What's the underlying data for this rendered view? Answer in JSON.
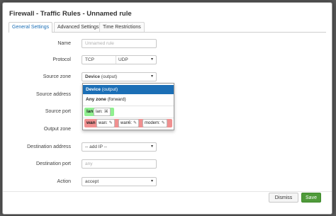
{
  "modal": {
    "title": "Firewall - Traffic Rules - Unnamed rule"
  },
  "tabs": [
    {
      "label": "General Settings"
    },
    {
      "label": "Advanced Settings"
    },
    {
      "label": "Time Restrictions"
    }
  ],
  "form": {
    "name_label": "Name",
    "name_placeholder": "Unnamed rule",
    "protocol_label": "Protocol",
    "protocol_tcp": "TCP",
    "protocol_udp": "UDP",
    "source_zone_label": "Source zone",
    "source_zone_value": "Device",
    "source_zone_value_note": "(output)",
    "source_address_label": "Source address",
    "source_port_label": "Source port",
    "output_zone_label": "Output zone",
    "destination_address_label": "Destination address",
    "destination_address_value": "-- add IP --",
    "destination_port_label": "Destination port",
    "destination_port_placeholder": "any",
    "action_label": "Action",
    "action_value": "accept"
  },
  "dropdown": {
    "items": [
      {
        "bold": "Device",
        "note": "(output)"
      },
      {
        "bold": "Any zone",
        "note": "(forward)"
      }
    ],
    "lan": {
      "zone": "lan",
      "networks": [
        "lan:"
      ]
    },
    "wan": {
      "zone": "wan",
      "networks": [
        "wan:",
        "wan6:",
        "modem:"
      ]
    }
  },
  "buttons": {
    "dismiss": "Dismiss",
    "save": "Save"
  },
  "colors": {
    "accent": "#1c6fb6",
    "save": "#4f9a3a",
    "lan_zone": "#90f090",
    "wan_zone": "#f09090"
  }
}
